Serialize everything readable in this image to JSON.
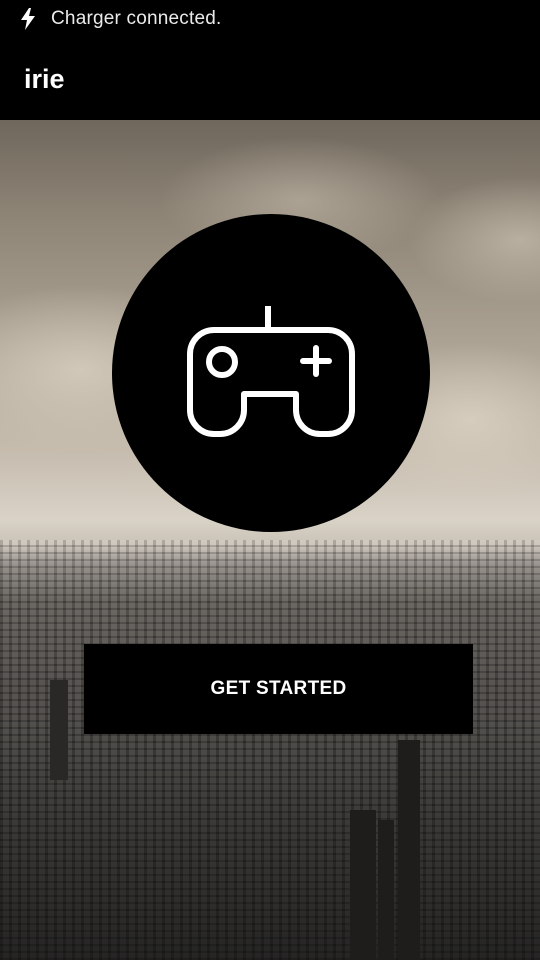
{
  "status_bar": {
    "icon": "charging-bolt-icon",
    "text": "Charger connected."
  },
  "app_bar": {
    "title": "irie"
  },
  "hero": {
    "background": "sepia city skyline photo",
    "badge_icon": "gamepad-icon"
  },
  "actions": {
    "get_started_label": "GET STARTED"
  },
  "colors": {
    "bar_background": "#000000",
    "text": "#ffffff",
    "circle": "#000000",
    "button": "#000000"
  }
}
